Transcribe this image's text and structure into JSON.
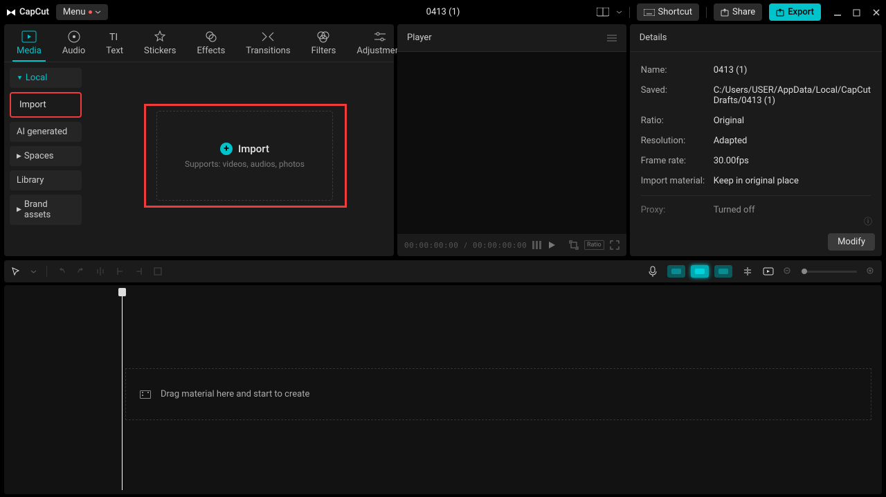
{
  "titlebar": {
    "app_name": "CapCut",
    "menu_label": "Menu",
    "project_title": "0413 (1)",
    "shortcut_label": "Shortcut",
    "share_label": "Share",
    "export_label": "Export"
  },
  "top_tabs": [
    {
      "label": "Media",
      "active": true
    },
    {
      "label": "Audio"
    },
    {
      "label": "Text"
    },
    {
      "label": "Stickers"
    },
    {
      "label": "Effects"
    },
    {
      "label": "Transitions"
    },
    {
      "label": "Filters"
    },
    {
      "label": "Adjustment"
    }
  ],
  "side_nav": {
    "local": "Local",
    "import": "Import",
    "ai": "AI generated",
    "spaces": "Spaces",
    "library": "Library",
    "brand": "Brand assets"
  },
  "import_box": {
    "title": "Import",
    "subtitle": "Supports: videos, audios, photos"
  },
  "player": {
    "title": "Player",
    "time_current": "00:00:00:00",
    "time_total": "00:00:00:00",
    "ratio_label": "Ratio"
  },
  "details": {
    "title": "Details",
    "name_k": "Name:",
    "name_v": "0413 (1)",
    "saved_k": "Saved:",
    "saved_v": "C:/Users/USER/AppData/Local/CapCut Drafts/0413 (1)",
    "ratio_k": "Ratio:",
    "ratio_v": "Original",
    "res_k": "Resolution:",
    "res_v": "Adapted",
    "fps_k": "Frame rate:",
    "fps_v": "30.00fps",
    "mat_k": "Import material:",
    "mat_v": "Keep in original place",
    "proxy_k": "Proxy:",
    "proxy_v": "Turned off",
    "modify": "Modify"
  },
  "timeline": {
    "hint": "Drag material here and start to create"
  }
}
